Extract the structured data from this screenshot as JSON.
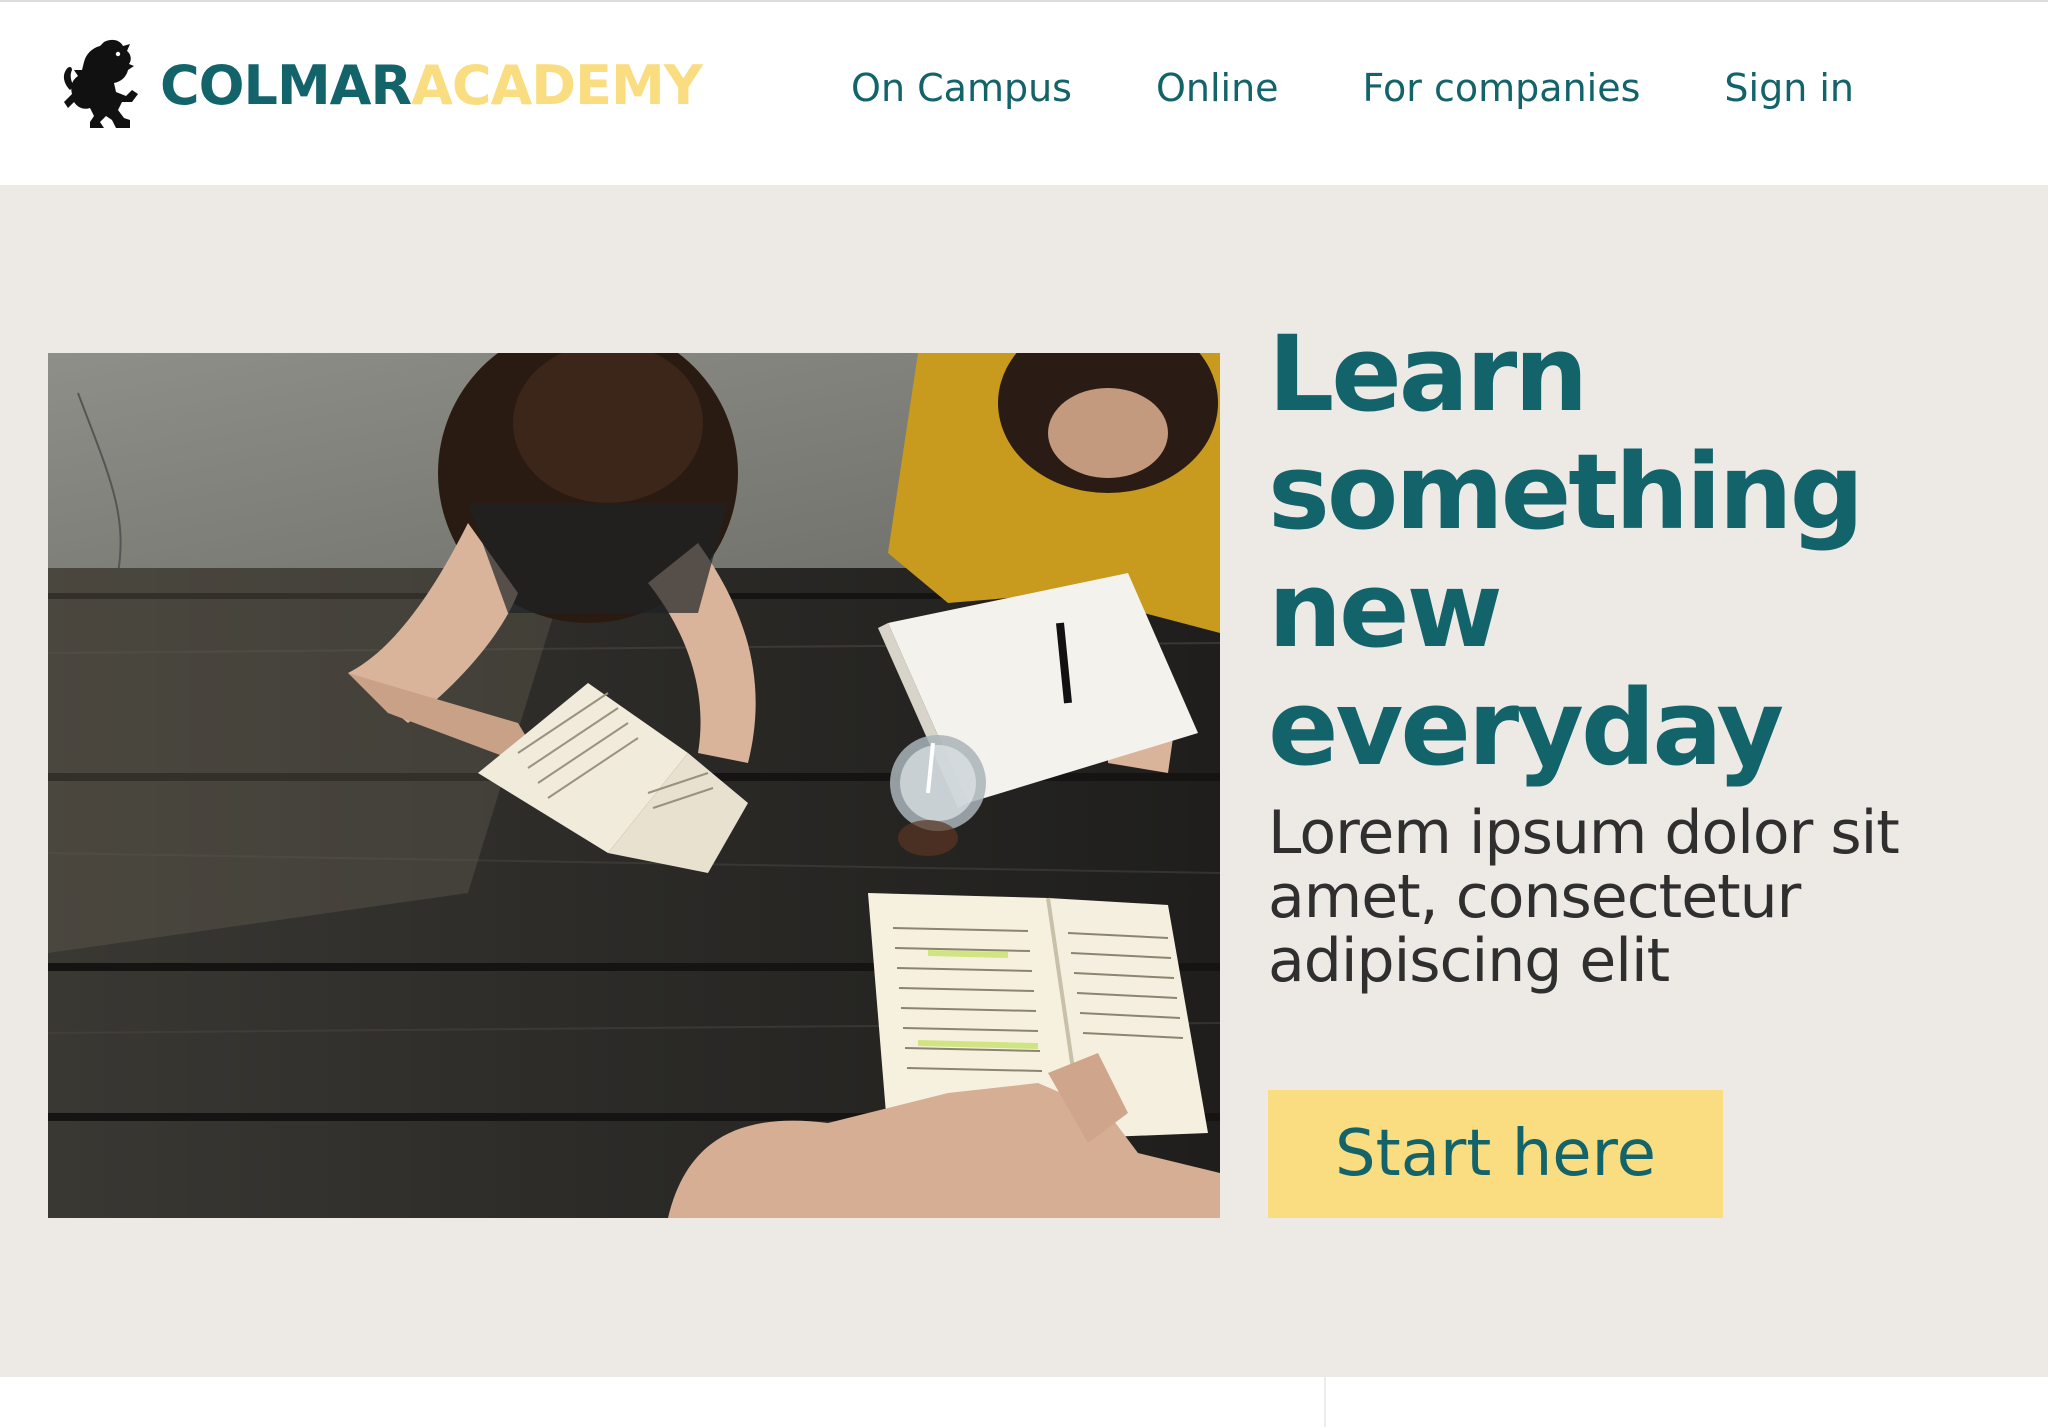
{
  "brand": {
    "name_part1": "COLMAR",
    "name_part2": "ACADEMY",
    "logo_icon": "lion-rampant-icon",
    "color_primary": "#13636b",
    "color_accent": "#f9dd80"
  },
  "nav": {
    "items": [
      {
        "label": "On Campus"
      },
      {
        "label": "Online"
      },
      {
        "label": "For companies"
      },
      {
        "label": "Sign in"
      }
    ]
  },
  "hero": {
    "headline": "Learn something new everyday",
    "subtext": "Lorem ipsum dolor sit amet, consectetur adipiscing elit",
    "cta_label": "Start here",
    "background_color": "#ede9e5",
    "image_alt": "Students reading and writing at a wooden picnic table"
  }
}
